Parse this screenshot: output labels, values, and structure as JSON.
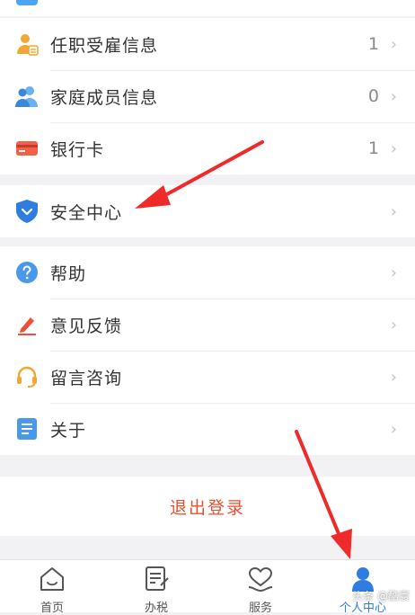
{
  "menu_group_1": [
    {
      "label": "任职受雇信息",
      "count": "1",
      "icon": "employment-person-icon"
    },
    {
      "label": "家庭成员信息",
      "count": "0",
      "icon": "family-members-icon"
    },
    {
      "label": "银行卡",
      "count": "1",
      "icon": "bank-card-icon"
    }
  ],
  "security": {
    "label": "安全中心",
    "icon": "shield-icon"
  },
  "menu_group_2": [
    {
      "label": "帮助",
      "icon": "question-circle-icon"
    },
    {
      "label": "意见反馈",
      "icon": "pencil-edit-icon"
    },
    {
      "label": "留言咨询",
      "icon": "headset-icon"
    },
    {
      "label": "关于",
      "icon": "document-list-icon"
    }
  ],
  "chevron": "›",
  "logout_label": "退出登录",
  "tabbar": {
    "tabs": [
      {
        "label": "首页",
        "icon": "home-icon"
      },
      {
        "label": "办税",
        "icon": "tax-form-icon"
      },
      {
        "label": "服务",
        "icon": "heart-hand-icon"
      },
      {
        "label": "个人中心",
        "icon": "user-profile-icon",
        "active": true
      }
    ]
  },
  "watermark": "头条 @酷寰",
  "colors": {
    "accent": "#2f7de1",
    "logout": "#e8502f",
    "annotation_arrow": "#ee2a2a",
    "background": "#f2f2f4"
  }
}
